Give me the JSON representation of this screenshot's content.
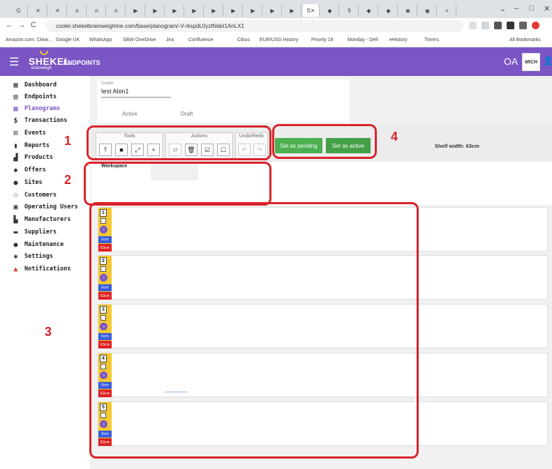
{
  "browser": {
    "url": "cooler.shekelbrainweighme.com/base/planogram/-V-rkspdL0yztNdeI1AnLX1",
    "window_controls": [
      "⌄",
      "–",
      "□",
      "✕"
    ],
    "bookmarks": [
      "Amazon.com: Clear...",
      "Google UK",
      "WhatsApp",
      "SBW OneDrive",
      "Jira",
      "Confluence",
      "Cibus",
      "EUR/USD History",
      "Priority 19",
      "Monday - Dell",
      "eHistory",
      "Timers",
      "All Bookmarks"
    ]
  },
  "app": {
    "brand": "SHEKEL",
    "brand_sub": "brainweigh",
    "section": "ENDPOINTS",
    "user_initials": "OA",
    "brand_badge": "MICH"
  },
  "sidebar": {
    "items": [
      {
        "label": "Dashboard",
        "icon": "dashboard-icon"
      },
      {
        "label": "Endpoints",
        "icon": "endpoints-icon"
      },
      {
        "label": "Planograms",
        "icon": "grid-icon"
      },
      {
        "label": "Transactions",
        "icon": "dollar-icon"
      },
      {
        "label": "Events",
        "icon": "events-icon"
      },
      {
        "label": "Reports",
        "icon": "bar-chart-icon"
      },
      {
        "label": "Products",
        "icon": "products-icon"
      },
      {
        "label": "Offers",
        "icon": "tag-icon"
      },
      {
        "label": "Sites",
        "icon": "pin-icon"
      },
      {
        "label": "Customers",
        "icon": "customers-icon"
      },
      {
        "label": "Operating Users",
        "icon": "id-card-icon"
      },
      {
        "label": "Manufacturers",
        "icon": "factory-icon"
      },
      {
        "label": "Suppliers",
        "icon": "truck-icon"
      },
      {
        "label": "Maintenance",
        "icon": "info-icon"
      },
      {
        "label": "Settings",
        "icon": "gear-icon"
      },
      {
        "label": "Notifications",
        "icon": "bell-icon"
      }
    ],
    "active": "Planograms"
  },
  "planogram": {
    "field_label": "Cooler",
    "field_value": "test Alon1",
    "tabs": [
      "Active",
      "Draft"
    ]
  },
  "toolbar": {
    "groups": [
      {
        "title": "Tools",
        "buttons": [
          "upload-icon",
          "square-icon",
          "expand-icon",
          "add-move-icon"
        ]
      },
      {
        "title": "Actions",
        "buttons": [
          "swap-icon",
          "trash-icon",
          "check-box-icon",
          "empty-box-icon"
        ]
      },
      {
        "title": "Undo/Redo",
        "buttons": [
          "undo-icon",
          "redo-icon"
        ]
      }
    ],
    "set_pending": "Set as pending",
    "set_active": "Set as active",
    "shelf_width": "Shelf width: 63cm"
  },
  "workspace": {
    "title": "Workspace"
  },
  "shelves": [
    {
      "number": "1",
      "used": "0cm",
      "width": "63cm"
    },
    {
      "number": "2",
      "used": "0cm",
      "width": "63cm"
    },
    {
      "number": "3",
      "used": "0cm",
      "width": "63cm"
    },
    {
      "number": "4",
      "used": "0cm",
      "width": "63cm"
    },
    {
      "number": "5",
      "used": "0cm",
      "width": "63cm"
    }
  ],
  "annotations": [
    "1",
    "2",
    "3",
    "4"
  ],
  "colors": {
    "brand_purple": "#7b55c4",
    "green": "#4caf50",
    "shelf_yellow": "#f4c92f",
    "annotation_red": "#d9232a"
  }
}
